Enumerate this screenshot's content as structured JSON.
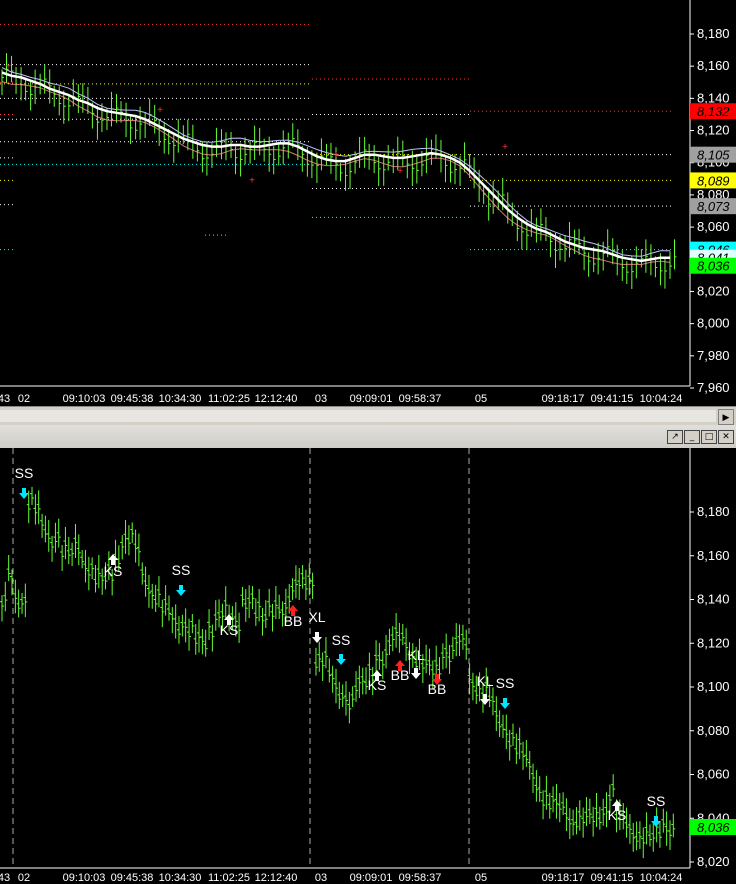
{
  "chart_data": [
    {
      "type": "line",
      "panel": "top",
      "y_ticks": [
        "8,180",
        "8,160",
        "8,140",
        "8,120",
        "8,100",
        "8,080",
        "8,060",
        "8,040",
        "8,020",
        "8,000",
        "7,980",
        "7,960"
      ],
      "x_labels": [
        "43",
        "02",
        "09:10:03",
        "09:45:38",
        "10:34:30",
        "11:02:25",
        "12:12:40",
        "03",
        "09:09:01",
        "09:58:37",
        "05",
        "09:18:17",
        "09:41:15",
        "10:04:24"
      ],
      "price_tags": [
        {
          "label": "8,132",
          "color": "#ff0000",
          "text_color": "#000000"
        },
        {
          "label": "8,105",
          "color": "#a0a0a0",
          "text_color": "#000000"
        },
        {
          "label": "8,089",
          "color": "#ffff00",
          "text_color": "#000000"
        },
        {
          "label": "8,073",
          "color": "#a0a0a0",
          "text_color": "#000000"
        },
        {
          "label": "8,046",
          "color": "#00ffff",
          "text_color": "#000000"
        },
        {
          "label": "8,041",
          "color": "#e0ffff",
          "text_color": "#000000"
        },
        {
          "label": "8,036",
          "color": "#00ff00",
          "text_color": "#000000"
        }
      ],
      "series": [
        {
          "values": [
            8156,
            8154,
            8153,
            8151,
            8149,
            8146,
            8144,
            8142,
            8139,
            8137,
            8134,
            8132,
            8131,
            8130,
            8129,
            8127,
            8124,
            8121,
            8118,
            8115,
            8113,
            8111,
            8110,
            8110,
            8111,
            8111,
            8110,
            8110,
            8111,
            8112,
            8112,
            8110,
            8107,
            8104,
            8102,
            8101,
            8101,
            8103,
            8105,
            8105,
            8104,
            8103,
            8103,
            8104,
            8105,
            8106,
            8105,
            8103,
            8100,
            8095,
            8089,
            8083,
            8077,
            8071,
            8066,
            8062,
            8059,
            8057,
            8054,
            8051,
            8049,
            8047,
            8046,
            8045,
            8043,
            8041,
            8040,
            8039,
            8040,
            8041,
            8041
          ]
        }
      ],
      "ylim": [
        7960,
        8190
      ]
    },
    {
      "type": "line",
      "panel": "bottom",
      "y_ticks": [
        "8,180",
        "8,160",
        "8,140",
        "8,120",
        "8,100",
        "8,080",
        "8,060",
        "8,040",
        "8,020"
      ],
      "x_labels": [
        "43",
        "02",
        "09:10:03",
        "09:45:38",
        "10:34:30",
        "11:02:25",
        "12:12:40",
        "03",
        "09:09:01",
        "09:58:37",
        "05",
        "09:18:17",
        "09:41:15",
        "10:04:24"
      ],
      "price_tag": {
        "label": "8,036",
        "color": "#00ff00"
      },
      "signals": [
        "SS",
        "KS",
        "SS",
        "KS",
        "BB",
        "XL",
        "SS",
        "KS",
        "BB",
        "KL",
        "BB",
        "KL",
        "SS",
        "KS",
        "SS"
      ],
      "series": [
        {
          "values": [
            8138,
            8150,
            8140,
            8141,
            8185,
            8180,
            8172,
            8168,
            8170,
            8163,
            8160,
            8164,
            8158,
            8155,
            8150,
            8148,
            8152,
            8160,
            8168,
            8168,
            8162,
            8150,
            8145,
            8142,
            8136,
            8132,
            8128,
            8130,
            8127,
            8121,
            8119,
            8127,
            8134,
            8136,
            8130,
            8128,
            8140,
            8142,
            8135,
            8130,
            8135,
            8138,
            8137,
            8142,
            8146,
            8148,
            8150,
            8113,
            8112,
            8104,
            8098,
            8097,
            8094,
            8100,
            8101,
            8107,
            8115,
            8114,
            8120,
            8123,
            8122,
            8116,
            8113,
            8109,
            8108,
            8110,
            8117,
            8115,
            8120,
            8120,
            8104,
            8100,
            8098,
            8093,
            8085,
            8082,
            8077,
            8072,
            8067,
            8062,
            8055,
            8050,
            8046,
            8045,
            8044,
            8040,
            8040,
            8039,
            8040,
            8042,
            8045,
            8052,
            8040,
            8038,
            8035,
            8033,
            8032,
            8030,
            8034,
            8038,
            8036
          ]
        }
      ],
      "ylim": [
        8015,
        8200
      ]
    }
  ]
}
